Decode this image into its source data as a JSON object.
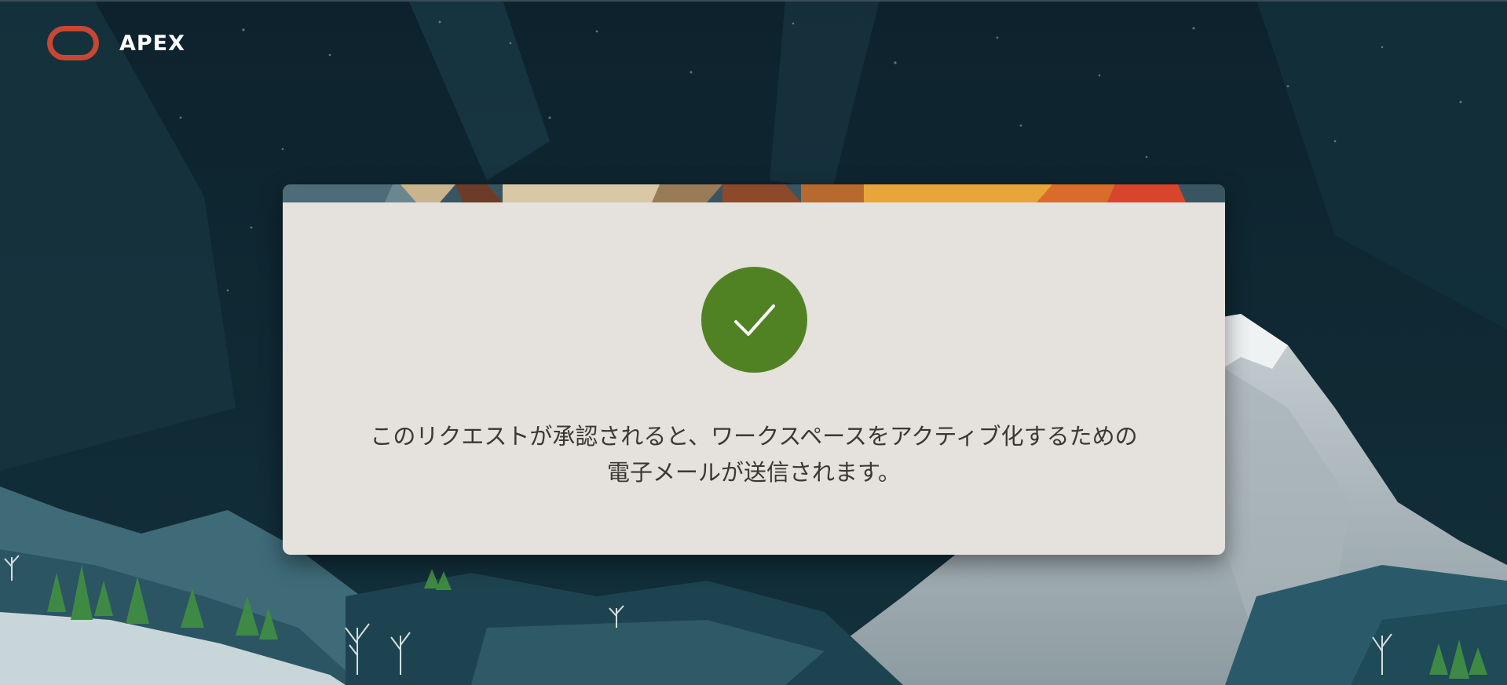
{
  "header": {
    "logo_icon": "oracle-logo-icon",
    "brand_name": "APEX",
    "brand_color": "#c74634"
  },
  "confirmation": {
    "status_icon": "checkmark-icon",
    "status_color": "#508223",
    "message_line1": "このリクエストが承認されると、ワークスペースをアクティブ化するための",
    "message_line2": "電子メールが送信されます。"
  }
}
